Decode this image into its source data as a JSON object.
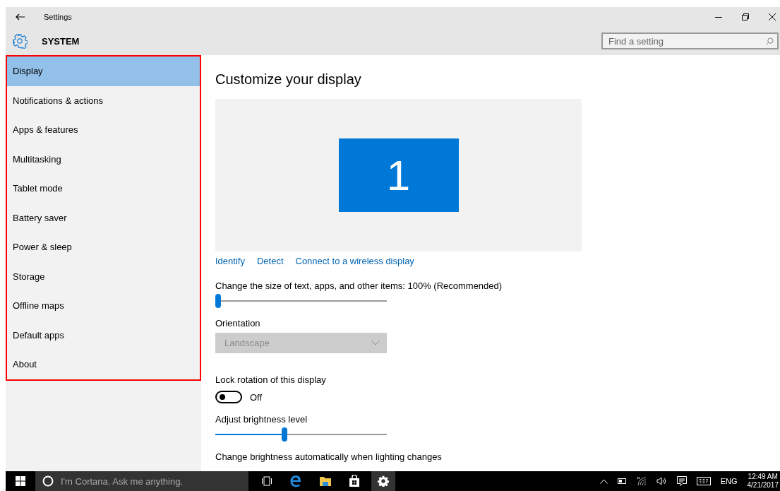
{
  "window": {
    "title": "Settings"
  },
  "header": {
    "title": "SYSTEM"
  },
  "search": {
    "placeholder": "Find a setting"
  },
  "sidebar": {
    "items": [
      {
        "label": "Display",
        "selected": true
      },
      {
        "label": "Notifications & actions",
        "selected": false
      },
      {
        "label": "Apps & features",
        "selected": false
      },
      {
        "label": "Multitasking",
        "selected": false
      },
      {
        "label": "Tablet mode",
        "selected": false
      },
      {
        "label": "Battery saver",
        "selected": false
      },
      {
        "label": "Power & sleep",
        "selected": false
      },
      {
        "label": "Storage",
        "selected": false
      },
      {
        "label": "Offline maps",
        "selected": false
      },
      {
        "label": "Default apps",
        "selected": false
      },
      {
        "label": "About",
        "selected": false
      }
    ]
  },
  "content": {
    "heading": "Customize your display",
    "display_number": "1",
    "links": [
      "Identify",
      "Detect",
      "Connect to a wireless display"
    ],
    "scale": {
      "label": "Change the size of text, apps, and other items: 100% (Recommended)",
      "level": 0.0
    },
    "orientation": {
      "label": "Orientation",
      "value": "Landscape",
      "disabled": true
    },
    "lock_rotation": {
      "label": "Lock rotation of this display",
      "on": false,
      "state": "Off"
    },
    "brightness": {
      "label": "Adjust brightness level",
      "level": 0.4
    },
    "auto_brightness": {
      "label": "Change brightness automatically when lighting changes"
    }
  },
  "taskbar": {
    "search_placeholder": "I'm Cortana. Ask me anything.",
    "language": "ENG",
    "time": "12:49 AM",
    "date": "4/21/2017"
  }
}
